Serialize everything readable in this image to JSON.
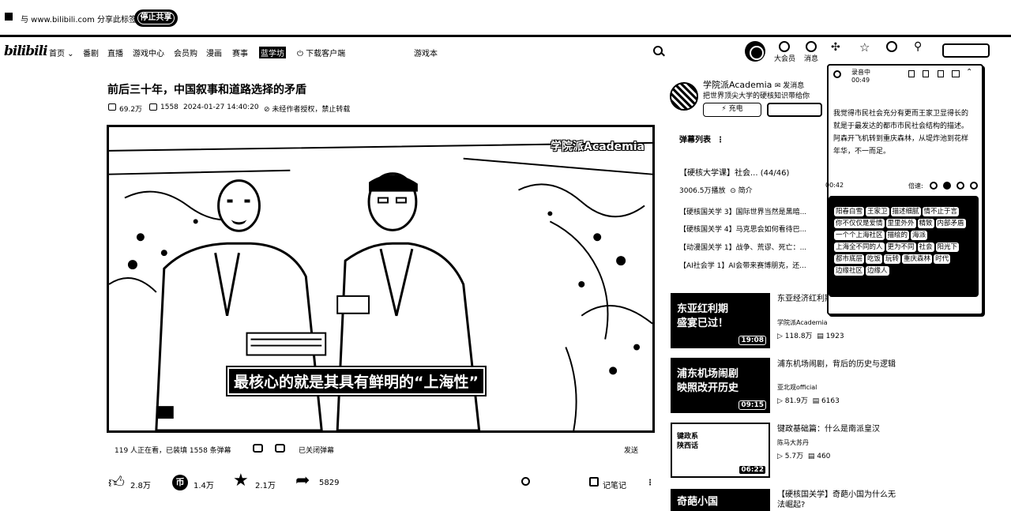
{
  "share_bar": {
    "text": "与 www.bilibili.com 分享此标签页",
    "stop_label": "停止共享"
  },
  "header": {
    "logo": "bilibili",
    "nav": [
      "首页",
      "番剧",
      "直播",
      "游戏中心",
      "会员购",
      "漫画",
      "赛事",
      "蓝学坊",
      "下载客户端"
    ],
    "nav_highlight": "蓝学坊",
    "search_placeholder": "游戏本",
    "right_labels": [
      "大会员",
      "消息"
    ]
  },
  "video": {
    "title": "前后三十年，中国叙事和道路选择的矛盾",
    "views": "69.2万",
    "danmaku_count": "1558",
    "date": "2024-01-27 14:40:20",
    "copyright": "未经作者授权，禁止转载",
    "watermark": "学院派Academia",
    "subtitle": "最核心的就是其具有鲜明的“上海性”",
    "watching": "119 人正在看，已装填 1558 条弹幕",
    "danmaku_closed": "已关闭弹幕",
    "send": "发送"
  },
  "actions": {
    "like": "2.8万",
    "coin": "1.4万",
    "fav": "2.1万",
    "share": "5829",
    "note": "记笔记"
  },
  "uploader": {
    "name": "学院派Academia",
    "message": "发消息",
    "desc": "把世界顶尖大学的硬核知识带给你",
    "charge": "充电"
  },
  "sidebar": {
    "danmaku_list": "弹幕列表",
    "playlist_title": "【硬核大学课】社会...",
    "playlist_count": "(44/46)",
    "playlist_meta": "3006.5万播放",
    "playlist_intro": "简介",
    "playlist_items": [
      "【硬核国关学 3】国际世界当然是黑暗...",
      "【硬核国关学 4】马克思会如何看待巴...",
      "【动漫国关学 1】战争、荒谬、死亡：...",
      "【AI社会学 1】AI会带来赛博朋克，还..."
    ],
    "recs": [
      {
        "thumb": "东亚红利期\n盛宴已过！",
        "duration": "19:08",
        "title": "东亚经济红利期结束 李佳琦翻车",
        "author": "学院派Academia",
        "views": "118.8万",
        "danmaku": "1923"
      },
      {
        "thumb": "浦东机场闹剧\n映照改开历史",
        "duration": "09:15",
        "title": "浦东机场闹剧，背后的历史与逻辑",
        "author": "亚北观official",
        "views": "81.9万",
        "danmaku": "6163"
      },
      {
        "thumb": "键政系\n陕西话",
        "duration": "06:22",
        "title": "键政基础篇：什么是南派皇汉",
        "author": "陈马大苏丹",
        "views": "5.7万",
        "danmaku": "460"
      },
      {
        "thumb": "奇葩小国",
        "duration": "",
        "title": "【硬核国关学】奇葩小国为什么无法崛起?",
        "author": "",
        "views": "",
        "danmaku": ""
      }
    ]
  },
  "popup": {
    "status": "录音中",
    "time": "00:49",
    "body": "我觉得市民社会充分有更而王家卫显得长的就是于最发达的都市市民社会结构的描述。阿森开飞机转到重庆森林，从堤炸池到花样年华，不一而足。",
    "position": "00:42",
    "speed": "倍速",
    "tags": [
      "阳春白雪",
      "王家卫",
      "描述细腻",
      "情不止于言",
      "你不仅仅是爱情",
      "里里外外",
      "精致",
      "内部矛盾",
      "一个个上海社区",
      "描绘的",
      "海派",
      "上海全不同的人",
      "更为不同",
      "社会",
      "阳光下",
      "都市底层",
      "吃饭",
      "玩转",
      "重庆森林",
      "时代",
      "边缘社区",
      "边缘人"
    ]
  },
  "colors": {
    "fg": "#000000",
    "bg": "#ffffff"
  }
}
